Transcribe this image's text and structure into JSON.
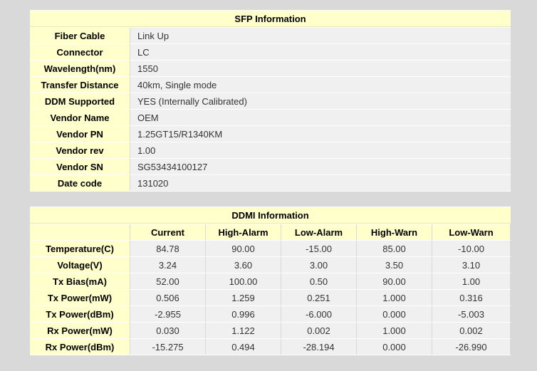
{
  "sfp": {
    "title": "SFP Information",
    "rows": [
      {
        "label": "Fiber Cable",
        "value": "Link Up"
      },
      {
        "label": "Connector",
        "value": "LC"
      },
      {
        "label": "Wavelength(nm)",
        "value": "1550"
      },
      {
        "label": "Transfer Distance",
        "value": "40km, Single mode"
      },
      {
        "label": "DDM Supported",
        "value": "YES (Internally Calibrated)"
      },
      {
        "label": "Vendor Name",
        "value": "OEM"
      },
      {
        "label": "Vendor PN",
        "value": "1.25GT15/R1340KM"
      },
      {
        "label": "Vendor rev",
        "value": "1.00"
      },
      {
        "label": "Vendor SN",
        "value": "SG53434100127"
      },
      {
        "label": "Date code",
        "value": "131020"
      }
    ]
  },
  "ddmi": {
    "title": "DDMI Information",
    "columns": [
      "Current",
      "High-Alarm",
      "Low-Alarm",
      "High-Warn",
      "Low-Warn"
    ],
    "rows": [
      {
        "label": "Temperature(C)",
        "values": [
          "84.78",
          "90.00",
          "-15.00",
          "85.00",
          "-10.00"
        ]
      },
      {
        "label": "Voltage(V)",
        "values": [
          "3.24",
          "3.60",
          "3.00",
          "3.50",
          "3.10"
        ]
      },
      {
        "label": "Tx Bias(mA)",
        "values": [
          "52.00",
          "100.00",
          "0.50",
          "90.00",
          "1.00"
        ]
      },
      {
        "label": "Tx Power(mW)",
        "values": [
          "0.506",
          "1.259",
          "0.251",
          "1.000",
          "0.316"
        ]
      },
      {
        "label": "Tx Power(dBm)",
        "values": [
          "-2.955",
          "0.996",
          "-6.000",
          "0.000",
          "-5.003"
        ]
      },
      {
        "label": "Rx Power(mW)",
        "values": [
          "0.030",
          "1.122",
          "0.002",
          "1.000",
          "0.002"
        ]
      },
      {
        "label": "Rx Power(dBm)",
        "values": [
          "-15.275",
          "0.494",
          "-28.194",
          "0.000",
          "-26.990"
        ]
      }
    ]
  }
}
